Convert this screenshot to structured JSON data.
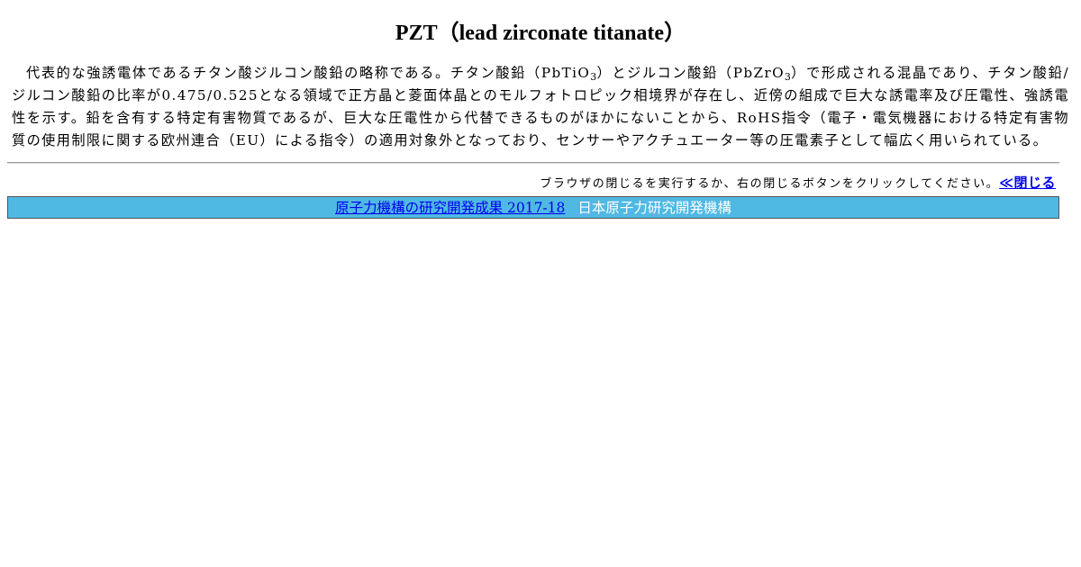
{
  "page": {
    "title": "PZT（lead zirconate titanate）"
  },
  "colors": {
    "footer_bg": "#4fb9e3",
    "link": "#0000ee",
    "footer_org_text": "#ffffff"
  },
  "content": {
    "p1": "代表的な強誘電体であるチタン酸ジルコン酸鉛の略称である。チタン酸鉛（PbTiO",
    "p1_sub": "3",
    "p2": "）とジルコン酸鉛（PbZrO",
    "p2_sub": "3",
    "p3": "）で形成される混晶であり、チタン酸鉛/ジルコン酸鉛の比率が0.475/0.525となる領域で正方晶と菱面体晶とのモルフォトロピック相境界が存在し、近傍の組成で巨大な誘電率及び圧電性、強誘電性を示す。鉛を含有する特定有害物質であるが、巨大な圧電性から代替できるものがほかにないことから、RoHS指令（電子・電気機器における特定有害物質の使用制限に関する欧州連合（EU）による指令）の適用対象外となっており、センサーやアクチュエーター等の圧電素子として幅広く用いられている。"
  },
  "close_bar": {
    "instruction": "ブラウザの閉じるを実行するか、右の閉じるボタンをクリックしてください。",
    "close_label": "≪閉じる"
  },
  "footer": {
    "link_label": "原子力機構の研究開発成果 2017-18",
    "org": "日本原子力研究開発機構"
  }
}
